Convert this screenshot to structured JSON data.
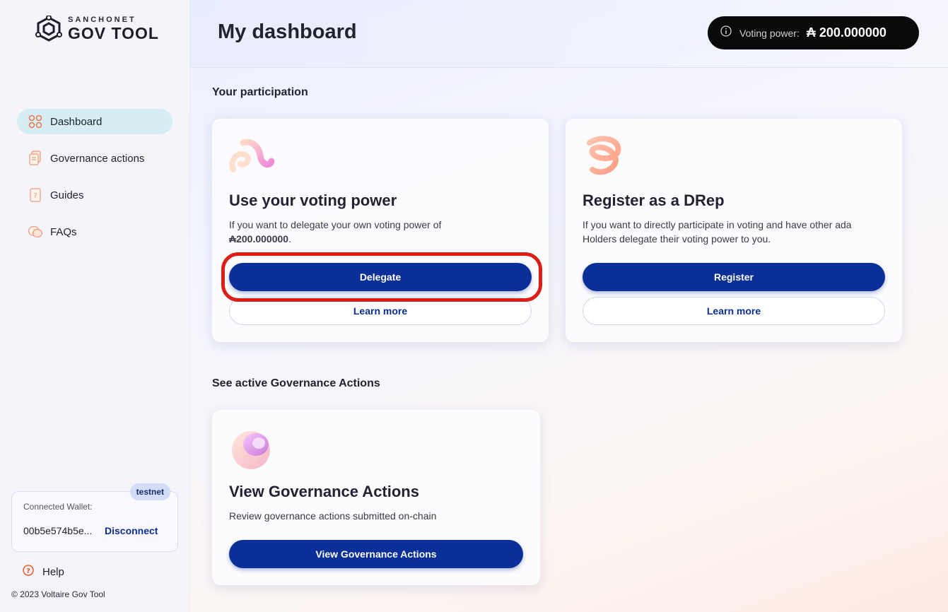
{
  "sidebar": {
    "logo": {
      "sub": "SANCHONET",
      "main": "GOV TOOL"
    },
    "nav": [
      {
        "label": "Dashboard",
        "icon": "dashboard-grid-icon",
        "active": true
      },
      {
        "label": "Governance actions",
        "icon": "documents-icon"
      },
      {
        "label": "Guides",
        "icon": "guide-book-icon"
      },
      {
        "label": "FAQs",
        "icon": "faq-chat-icon"
      }
    ],
    "wallet": {
      "badge": "testnet",
      "label": "Connected Wallet:",
      "address": "00b5e574b5e...",
      "disconnect": "Disconnect"
    },
    "help": "Help",
    "copyright": "© 2023 Voltaire Gov Tool"
  },
  "header": {
    "title": "My dashboard",
    "voting_power_label": "Voting power:",
    "voting_power_value": "₳ 200.000000"
  },
  "participation": {
    "section_title": "Your participation",
    "cards": [
      {
        "title": "Use your voting power",
        "desc_prefix": "If you want to delegate your own voting power of",
        "desc_amount": "₳200.000000",
        "desc_suffix": ".",
        "primary": "Delegate",
        "secondary": "Learn more"
      },
      {
        "title": "Register as a DRep",
        "desc": "If you want to directly participate in voting and have other ada Holders delegate their voting power to you.",
        "primary": "Register",
        "secondary": "Learn more"
      }
    ]
  },
  "governance": {
    "section_title": "See active Governance Actions",
    "card": {
      "title": "View Governance Actions",
      "desc": "Review governance actions submitted on-chain",
      "primary": "View Governance Actions"
    }
  },
  "colors": {
    "primary": "#0a2f98",
    "accent_orange": "#ee7b4f",
    "highlight": "#dc1f16"
  }
}
